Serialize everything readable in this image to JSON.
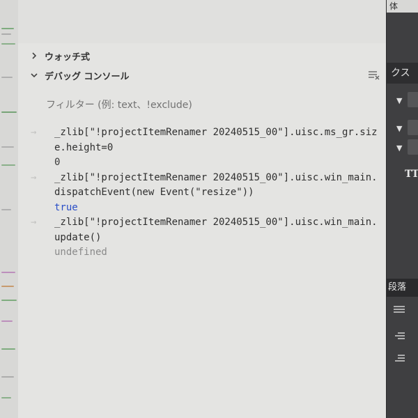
{
  "sections": {
    "watch": {
      "label": "ウォッチ式"
    },
    "debug_console": {
      "label": "デバッグ コンソール"
    }
  },
  "filter": {
    "placeholder": "フィルター (例: text、!exclude)"
  },
  "console": {
    "entries": [
      {
        "input": "_zlib[\"!projectItemRenamer 20240515_00\"].uisc.ms_gr.size.height=0",
        "output": "0",
        "output_type": "number"
      },
      {
        "input": "_zlib[\"!projectItemRenamer 20240515_00\"].uisc.win_main.dispatchEvent(new Event(\"resize\"))",
        "output": "true",
        "output_type": "boolean"
      },
      {
        "input": "_zlib[\"!projectItemRenamer 20240515_00\"].uisc.win_main.update()",
        "output": "undefined",
        "output_type": "undefined"
      }
    ],
    "prompt_glyph": "→"
  },
  "right_panel": {
    "top_label": "体",
    "header_label": "クス",
    "tt_label": "TT",
    "tab_label": "段落"
  },
  "colors": {
    "panel_bg": "#e4e4e2",
    "boolean_blue": "#2a4ec7",
    "dark_panel": "#3f3f41"
  },
  "icons": [
    "chevron-right-icon",
    "chevron-down-icon",
    "clear-console-icon",
    "dropdown-arrow-icon",
    "align-icon"
  ]
}
